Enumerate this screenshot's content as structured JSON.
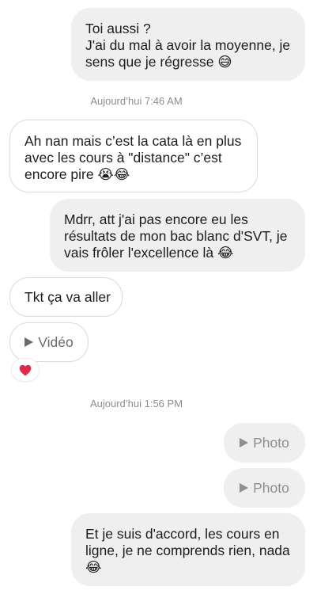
{
  "messages": [
    {
      "lines": [
        "Toi aussi ?",
        "J'ai du mal à avoir la moyenne, je",
        "sens que je régresse 😅"
      ]
    },
    {
      "lines": [
        "Ah nan mais c’est la cata là en plus",
        "avec les cours à \"distance\" c’est",
        "encore pire 😭😂"
      ]
    },
    {
      "lines": [
        "Mdrr, att j'ai pas encore eu les",
        "résultats de mon bac blanc d'SVT, je",
        "vais frôler l'excellence là 😂"
      ]
    },
    {
      "lines": [
        "Tkt ça va aller"
      ]
    },
    {
      "lines": [
        "Et je suis d'accord, les cours en",
        "ligne, je ne comprends rien, nada",
        "😂"
      ]
    }
  ],
  "timestamps": [
    "Aujourd’hui 7:46 AM",
    "Aujourd’hui 1:56 PM"
  ],
  "media": {
    "video_label": "Vidéo",
    "photo_label": "Photo"
  },
  "reaction": {
    "emoji": "❤️",
    "icon": "heart-icon",
    "color": "#e0284a"
  },
  "colors": {
    "outgoing_bubble": "#efefef",
    "incoming_border": "#dadada",
    "timestamp": "#8e8e8e"
  }
}
